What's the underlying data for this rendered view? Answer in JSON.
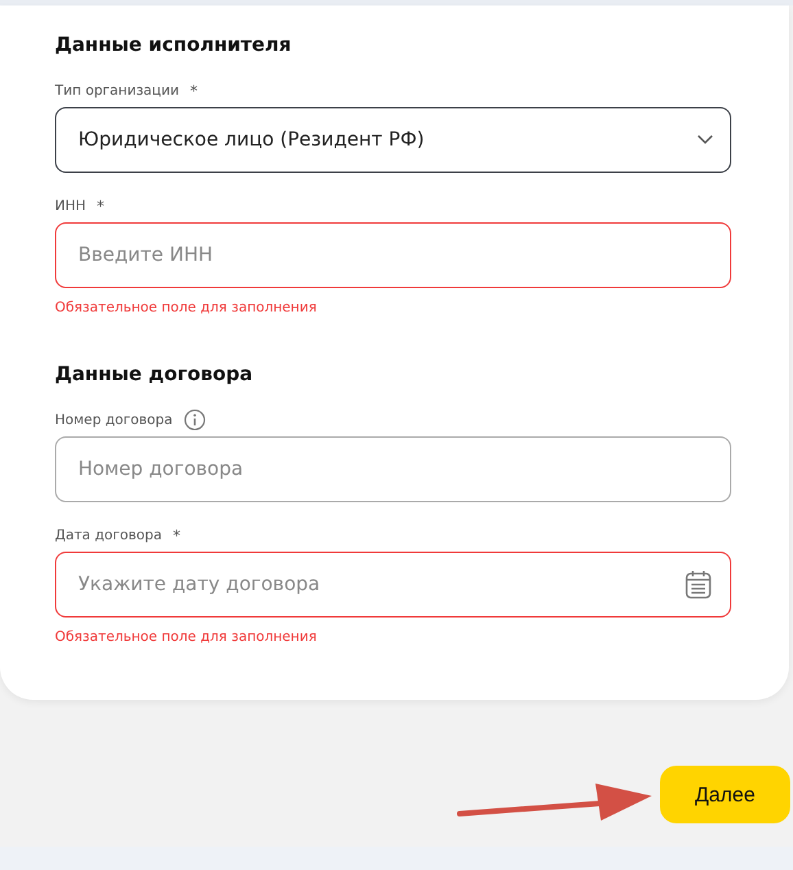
{
  "sections": [
    {
      "title": "Данные исполнителя",
      "fields": [
        {
          "kind": "select",
          "label": "Тип организации",
          "required_mark": "*",
          "info": false,
          "value": "Юридическое лицо (Резидент РФ)"
        },
        {
          "kind": "text",
          "label": "ИНН",
          "required_mark": "*",
          "info": false,
          "placeholder": "Введите ИНН",
          "error": "Обязательное поле для заполнения"
        }
      ]
    },
    {
      "title": "Данные договора",
      "fields": [
        {
          "kind": "text",
          "label": "Номер договора",
          "info": true,
          "placeholder": "Номер договора"
        },
        {
          "kind": "date",
          "label": "Дата договора",
          "required_mark": "*",
          "info": false,
          "placeholder": "Укажите дату договора",
          "error": "Обязательное поле для заполнения"
        }
      ]
    }
  ],
  "next_button": "Далее"
}
